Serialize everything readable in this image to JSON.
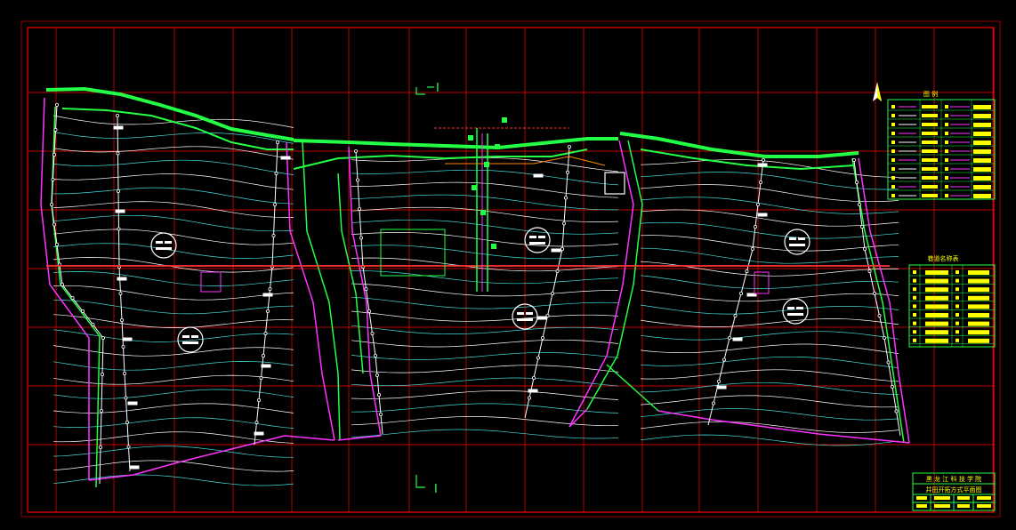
{
  "colors": {
    "background": "#000000",
    "frame": "#ff0000",
    "grid": "#ff0000",
    "seam_crop": "#22ff44",
    "contour_white": "#ffffff",
    "contour_cyan": "#44dddd",
    "fault_magenta": "#ff33ff",
    "table_yellow": "#ffff00",
    "table_green": "#22ff44",
    "marker_white": "#ffffff",
    "section_line": "#ff0000"
  },
  "section_markers": {
    "top": "I",
    "bottom": "I"
  },
  "legend_table": {
    "title": "图 例",
    "rows": 11
  },
  "roadway_table": {
    "title": "巷道名称表",
    "rows": 9
  },
  "title_block": {
    "school": "黑 龙 江 科 技 学 院",
    "drawing_name": "井田开拓方式平面图"
  },
  "icons": {
    "north": "north-arrow-icon",
    "panel_marker": "circled-panel-marker-icon"
  }
}
